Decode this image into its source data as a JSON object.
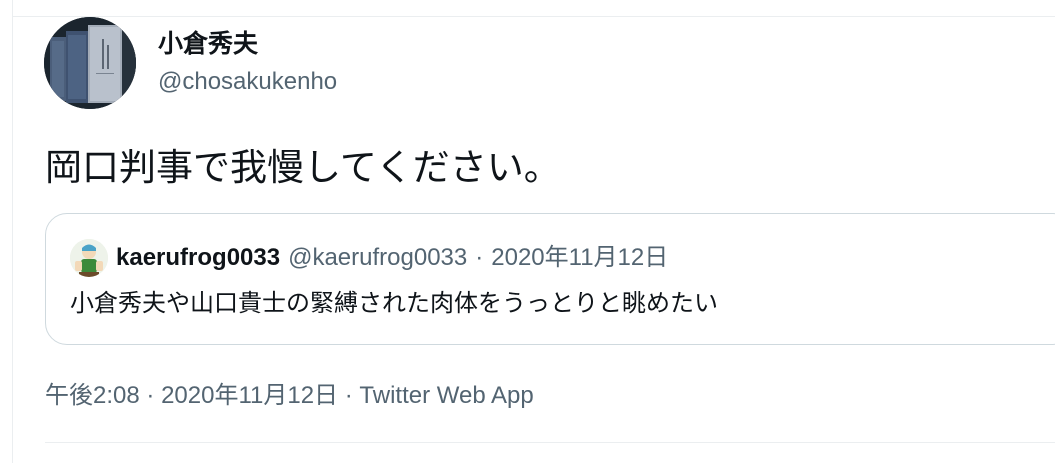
{
  "author": {
    "display_name": "小倉秀夫",
    "handle": "@chosakukenho"
  },
  "tweet": {
    "text": "岡口判事で我慢してください。"
  },
  "quoted_tweet": {
    "display_name": "kaerufrog0033",
    "handle": "@kaerufrog0033",
    "separator": "·",
    "date": "2020年11月12日",
    "text": "小倉秀夫や山口貴士の緊縛された肉体をうっとりと眺めたい"
  },
  "meta": {
    "time": "午後2:08",
    "separator": "·",
    "date": "2020年11月12日",
    "source": "Twitter Web App"
  },
  "colors": {
    "primary_text": "#0f1419",
    "secondary_text": "#536471",
    "border": "#cfd9de",
    "divider": "#ebeef0"
  },
  "icons": {
    "author_avatar": "profile-photo-books",
    "quote_avatar": "profile-photo-cartoon"
  }
}
